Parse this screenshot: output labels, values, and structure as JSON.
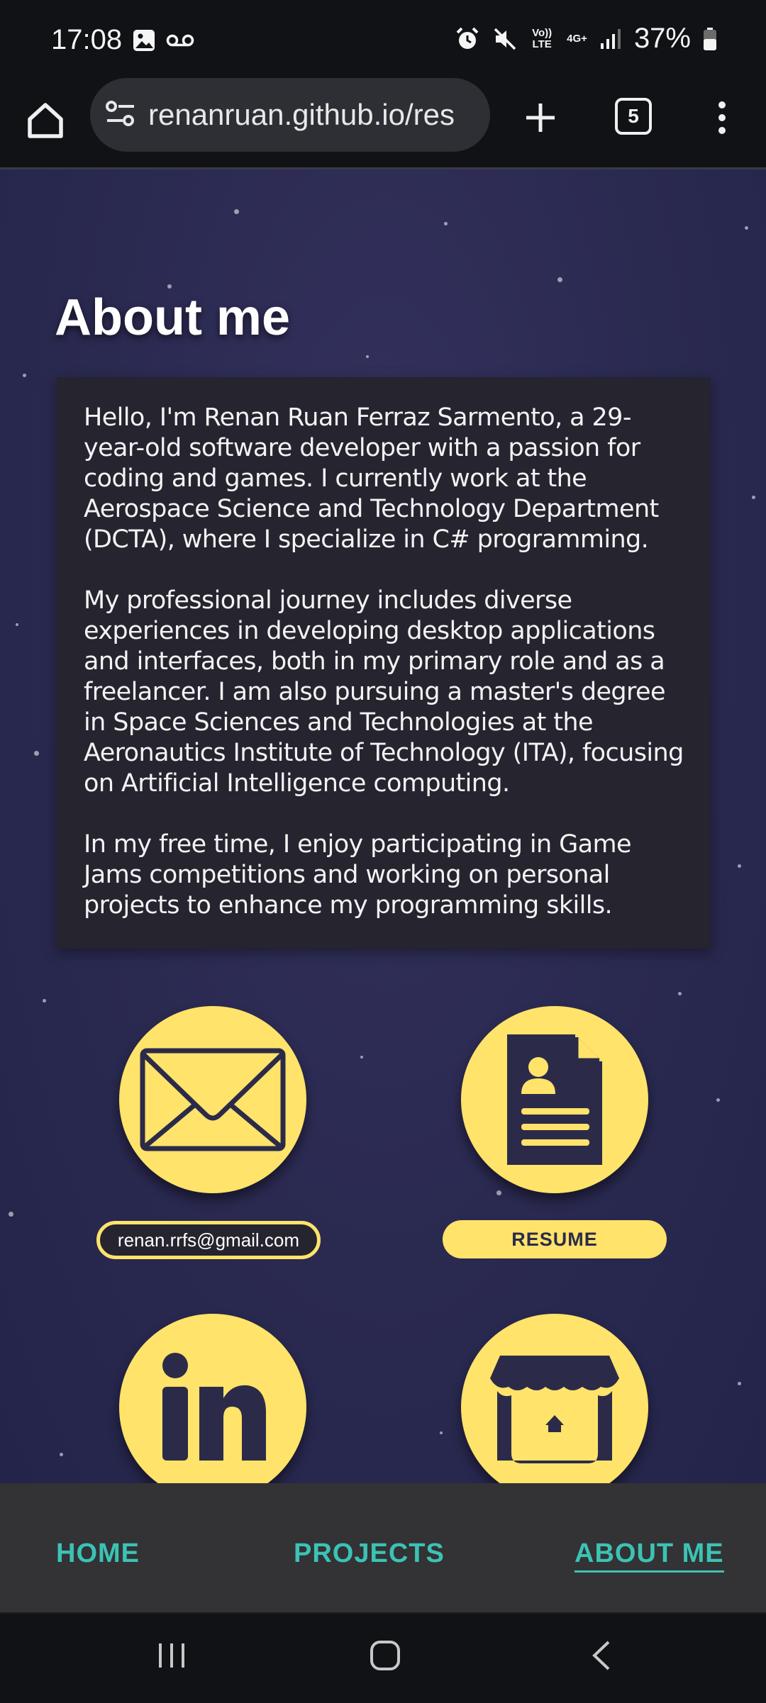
{
  "status_bar": {
    "time": "17:08",
    "battery": "37%",
    "network_volte": "Vo)) LTE",
    "network_type": "4G+"
  },
  "browser": {
    "url": "renanruan.github.io/res",
    "tab_count": "5"
  },
  "about": {
    "title": "About me",
    "paragraphs": [
      "Hello, I'm Renan Ruan Ferraz Sarmento, a 29-year-old software developer with a passion for coding and games. I currently work at the Aerospace Science and Technology Department (DCTA), where I specialize in C# programming.",
      "My professional journey includes diverse experiences in developing desktop applications and interfaces, both in my primary role and as a freelancer. I am also pursuing a master's degree in Space Sciences and Technologies at the Aeronautics Institute of Technology (ITA), focusing on Artificial Intelligence computing.",
      "In my free time, I enjoy participating in Game Jams competitions and working on personal projects to enhance my programming skills."
    ]
  },
  "contacts": {
    "email": "renan.rrfs@gmail.com",
    "resume": "RESUME"
  },
  "nav": {
    "home": "HOME",
    "projects": "PROJECTS",
    "about": "ABOUT ME",
    "active": "about"
  },
  "colors": {
    "accent_yellow": "#ffe36b",
    "nav_teal": "#3bc3b5",
    "page_bg": "#2a2950",
    "card_bg": "#25242f"
  }
}
